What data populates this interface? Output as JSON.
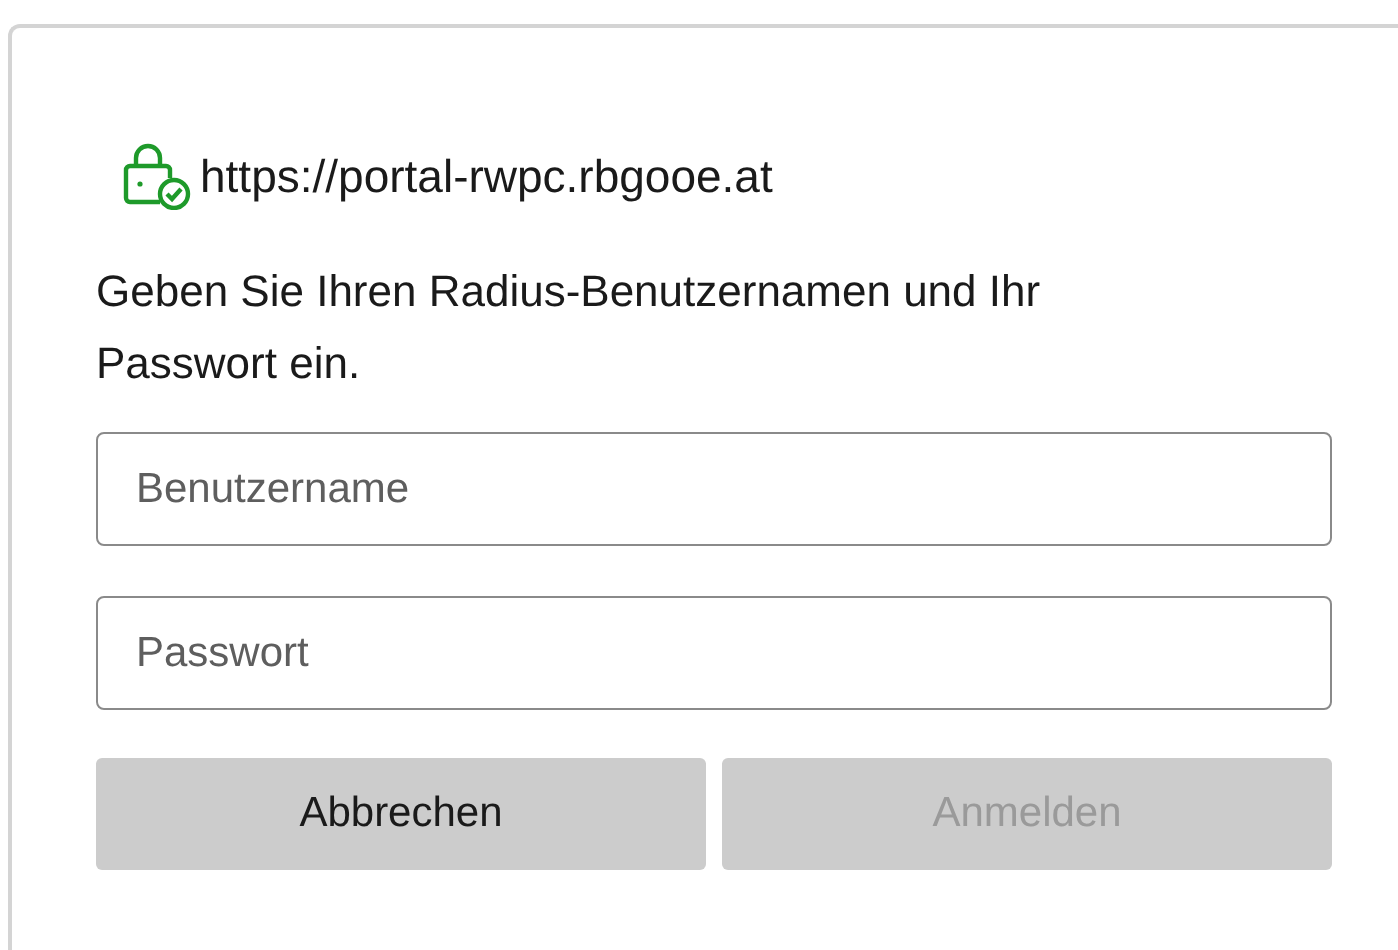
{
  "site": {
    "url": "https://portal-rwpc.rbgooe.at",
    "secure": true
  },
  "prompt": "Geben Sie Ihren Radius-Benutzernamen und Ihr Passwort ein.",
  "fields": [
    {
      "placeholder": "Benutzername"
    },
    {
      "placeholder": "Passwort"
    }
  ],
  "buttons": [
    {
      "label": "Abbrechen",
      "disabled": false
    },
    {
      "label": "Anmelden",
      "disabled": true
    }
  ]
}
